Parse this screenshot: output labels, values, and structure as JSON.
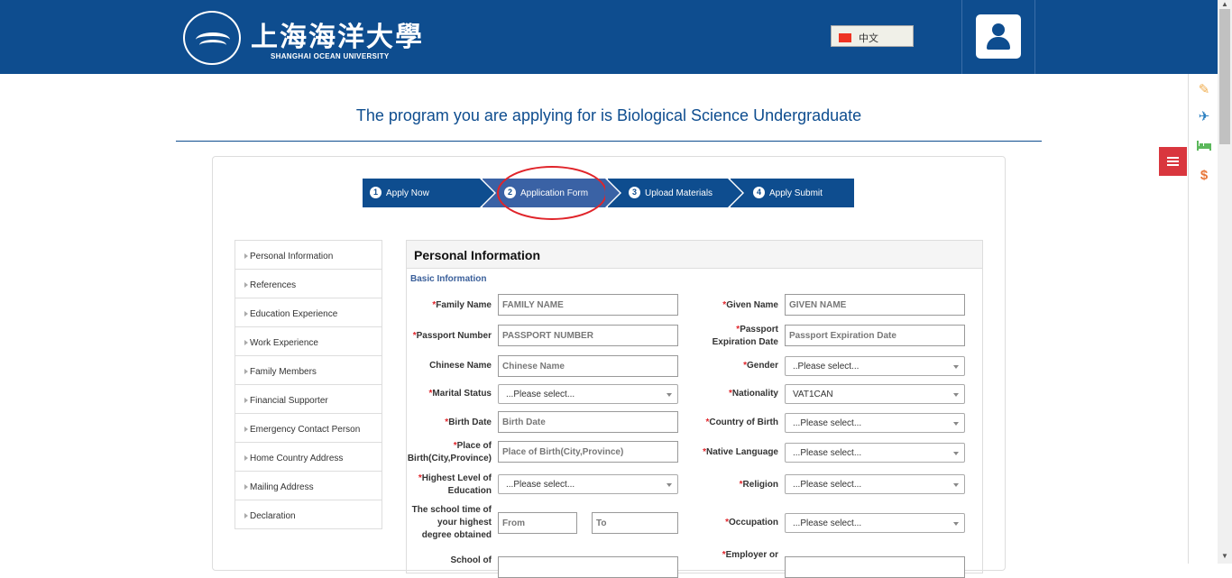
{
  "header": {
    "logo_cn": "上海海洋大學",
    "logo_en": "SHANGHAI OCEAN UNIVERSITY",
    "lang_label": "中文",
    "brand_color": "#0e4d8f"
  },
  "program_title": "The program you are applying for is Biological Science Undergraduate",
  "steps": [
    {
      "num": "1",
      "label": "Apply Now"
    },
    {
      "num": "2",
      "label": "Application Form"
    },
    {
      "num": "3",
      "label": "Upload Materials"
    },
    {
      "num": "4",
      "label": "Apply Submit"
    }
  ],
  "active_step": 2,
  "sidenav": [
    "Personal Information",
    "References",
    "Education Experience",
    "Work Experience",
    "Family Members",
    "Financial Supporter",
    "Emergency Contact Person",
    "Home Country Address",
    "Mailing Address",
    "Declaration"
  ],
  "form": {
    "title": "Personal Information",
    "section": "Basic Information",
    "required_mark": "*",
    "fields": {
      "family_name": {
        "label": "Family Name",
        "placeholder": "FAMILY NAME"
      },
      "given_name": {
        "label": "Given Name",
        "placeholder": "GIVEN NAME"
      },
      "passport_number": {
        "label": "Passport Number",
        "placeholder": "PASSPORT NUMBER"
      },
      "passport_expiration": {
        "label1": "Passport",
        "label2": "Expiration Date",
        "placeholder": "Passport Expiration Date"
      },
      "chinese_name": {
        "label": "Chinese Name",
        "placeholder": "Chinese Name"
      },
      "gender": {
        "label": "Gender",
        "value": "..Please select..."
      },
      "marital_status": {
        "label": "Marital Status",
        "value": "...Please select..."
      },
      "nationality": {
        "label": "Nationality",
        "value": "VAT1CAN"
      },
      "birth_date": {
        "label": "Birth Date",
        "placeholder": "Birth Date"
      },
      "country_of_birth": {
        "label": "Country of Birth",
        "value": "...Please select..."
      },
      "place_of_birth": {
        "label1": "Place of",
        "label2": "Birth(City,Province)",
        "placeholder": "Place of Birth(City,Province)"
      },
      "native_language": {
        "label": "Native Language",
        "value": "...Please select..."
      },
      "highest_education": {
        "label1": "Highest Level of",
        "label2": "Education",
        "value": "...Please select..."
      },
      "religion": {
        "label": "Religion",
        "value": "...Please select..."
      },
      "school_time": {
        "label1": "The school time of",
        "label2": "your highest",
        "label3": "degree obtained",
        "from": "From",
        "to": "To"
      },
      "occupation": {
        "label": "Occupation",
        "value": "...Please select..."
      },
      "school_of": {
        "label": "School of"
      },
      "employer": {
        "label": "Employer or"
      }
    }
  }
}
